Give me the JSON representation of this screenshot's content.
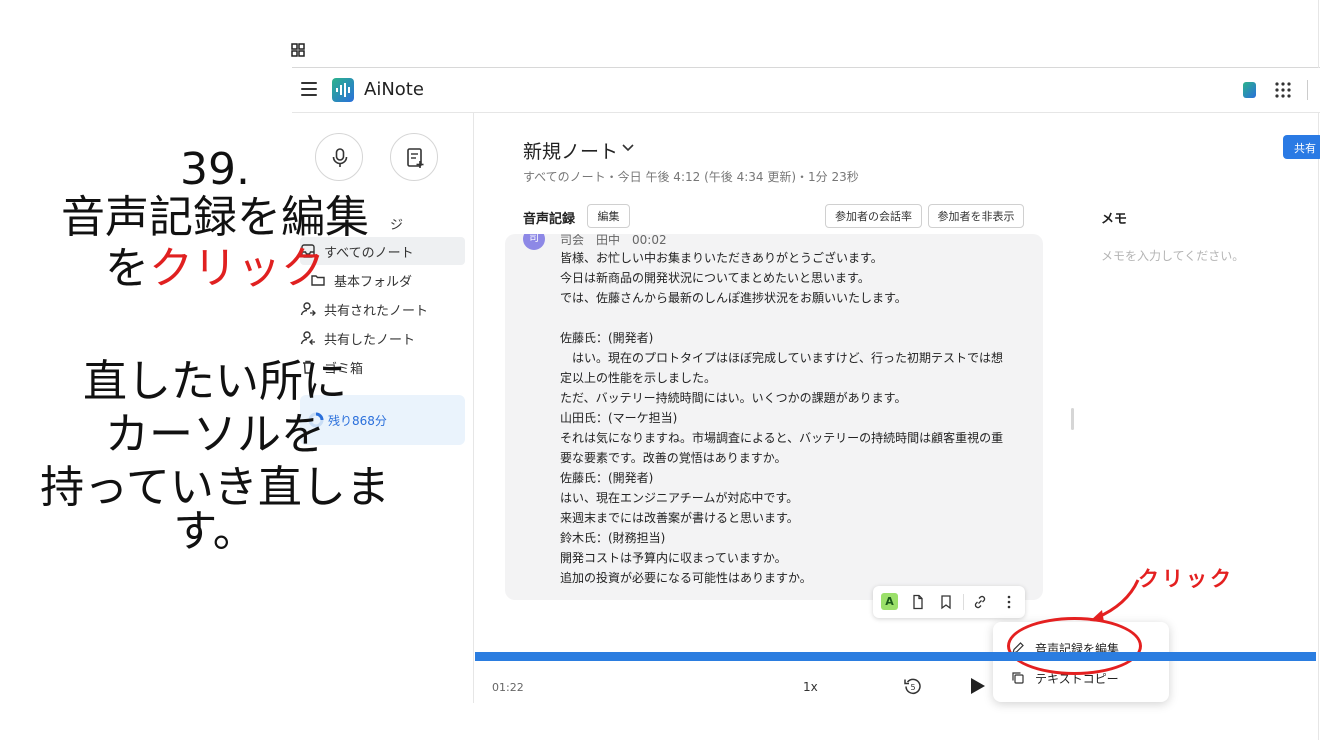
{
  "annotation": {
    "step": "39.",
    "line1": "音声記録を編集",
    "line2_prefix": "を",
    "line2_red": "クリック",
    "line3": "直したい所に",
    "line4": "カーソルを",
    "line5": "持っていき直します。",
    "click_label": "クリック"
  },
  "app": {
    "name": "AiNote"
  },
  "sidebar": {
    "partial_label": "ジ",
    "items": [
      {
        "label": "すべてのノート"
      },
      {
        "label": "基本フォルダ"
      },
      {
        "label": "共有されたノート"
      },
      {
        "label": "共有したノート"
      },
      {
        "label": "ゴミ箱"
      }
    ],
    "remaining": "残り868分"
  },
  "note": {
    "title": "新規ノート",
    "meta": "すべてのノート・今日 午後 4:12 (午後 4:34 更新)・1分 23秒",
    "share": "共有"
  },
  "transcript": {
    "label": "音声記録",
    "edit_button": "編集",
    "btn_talk_rate": "参加者の会話率",
    "btn_hide_participants": "参加者を非表示",
    "speaker_avatar": "司",
    "speaker_line": "司会　田中　00:02",
    "lines": [
      "皆様、お忙しい中お集まりいただきありがとうございます。",
      "今日は新商品の開発状況についてまとめたいと思います。",
      "では、佐藤さんから最新のしんぽ進捗状況をお願いいたします。",
      "",
      "佐藤氏：(開発者)",
      "　はい。現在のプロトタイプはほぼ完成していますけど、行った初期テストでは想",
      "定以上の性能を示しました。",
      "ただ、バッテリー持続時間にはい。いくつかの課題があります。",
      "山田氏：(マーケ担当)",
      "それは気になりますね。市場調査によると、バッテリーの持続時間は顧客重視の重",
      "要な要素です。改善の覚悟はありますか。",
      "佐藤氏：(開発者)",
      "はい、現在エンジニアチームが対応中です。",
      "来週末までには改善案が書けると思います。",
      "鈴木氏：(財務担当)",
      "開発コストは予算内に収まっていますか。",
      "追加の投資が必要になる可能性はありますか。"
    ]
  },
  "memo": {
    "title": "メモ",
    "placeholder": "メモを入力してください。"
  },
  "toolbar": {
    "a_label": "A"
  },
  "context_menu": {
    "edit_transcript": "音声記録を編集",
    "copy_text": "テキストコピー"
  },
  "player": {
    "current_time": "01:22",
    "speed": "1x",
    "rewind_seconds": "5"
  },
  "colors": {
    "accent": "#2b7de0",
    "annotation_red": "#e42020"
  }
}
